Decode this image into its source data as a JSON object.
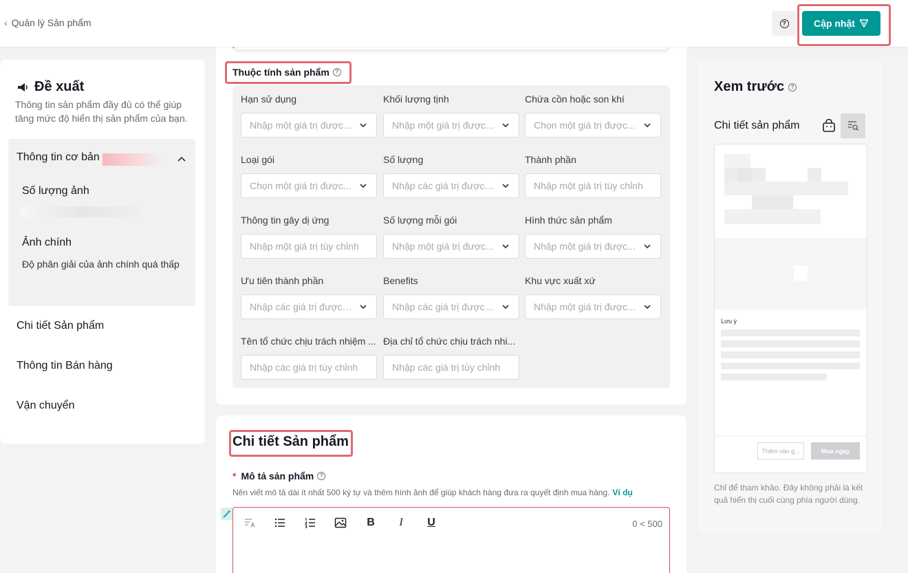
{
  "header": {
    "back_label": "Quản lý Sản phẩm",
    "update_label": "Cập nhật"
  },
  "sidebar": {
    "suggest_title": "Đề xuất",
    "suggest_desc": "Thông tin sản phẩm đầy đủ có thể giúp tăng mức độ hiển thị sản phẩm của bạn.",
    "basic_info_label": "Thông tin cơ bản",
    "image_count_label": "Số lượng ảnh",
    "main_image_label": "Ảnh chính",
    "main_image_desc": "Độ phân giải của ảnh chính quá thấp",
    "nav": [
      "Chi tiết Sản phẩm",
      "Thông tin Bán hàng",
      "Vận chuyển"
    ]
  },
  "attributes": {
    "title": "Thuộc tính sản phẩm",
    "fields": [
      {
        "label": "Hạn sử dụng",
        "placeholder": "Nhập một giá trị được...",
        "dropdown": true
      },
      {
        "label": "Khối lượng tịnh",
        "placeholder": "Nhập một giá trị được...",
        "dropdown": true
      },
      {
        "label": "Chứa cồn hoặc son khí",
        "placeholder": "Chọn một giá trị được...",
        "dropdown": true
      },
      {
        "label": "Loại gói",
        "placeholder": "Chọn một giá trị được...",
        "dropdown": true
      },
      {
        "label": "Số lượng",
        "placeholder": "Nhập các giá trị được ...",
        "dropdown": true
      },
      {
        "label": "Thành phần",
        "placeholder": "Nhập một giá trị tùy chỉnh",
        "dropdown": false
      },
      {
        "label": "Thông tin gây dị ứng",
        "placeholder": "Nhập một giá trị tùy chỉnh",
        "dropdown": false
      },
      {
        "label": "Số lượng mỗi gói",
        "placeholder": "Nhập một giá trị được...",
        "dropdown": true
      },
      {
        "label": "Hình thức sản phẩm",
        "placeholder": "Nhập một giá trị được...",
        "dropdown": true
      },
      {
        "label": "Ưu tiên thành phần",
        "placeholder": "Nhập các giá trị được ...",
        "dropdown": true
      },
      {
        "label": "Benefits",
        "placeholder": "Nhập các giá trị được ...",
        "dropdown": true
      },
      {
        "label": "Khu vực xuất xứ",
        "placeholder": "Nhập một giá trị được...",
        "dropdown": true
      },
      {
        "label": "Tên tổ chức chịu trách nhiệm ...",
        "placeholder": "Nhập các giá trị tùy chỉnh",
        "dropdown": false
      },
      {
        "label": "Địa chỉ tổ chức chịu trách nhi...",
        "placeholder": "Nhập các giá trị tùy chỉnh",
        "dropdown": false
      }
    ]
  },
  "detail": {
    "title": "Chi tiết Sản phẩm",
    "desc_required_mark": "*",
    "desc_label": "Mô tả sản phẩm",
    "desc_hint": "Nên viết mô tả dài ít nhất 500 ký tự và thêm hình ảnh để giúp khách hàng đưa ra quyết định mua hàng.",
    "desc_hint_link": "Ví dụ",
    "counter": "0 < 500",
    "toolbar_icons": [
      "text-style-icon",
      "bullet-list-icon",
      "numbered-list-icon",
      "image-icon",
      "bold-icon",
      "italic-icon",
      "underline-icon"
    ]
  },
  "preview": {
    "title": "Xem trước",
    "sub_title": "Chi tiết sản phẩm",
    "note_label": "Lưu ý",
    "add_to_cart": "Thêm vào g...",
    "buy_now": "Mua ngay",
    "disclaimer": "Chỉ để tham khảo. Đây không phải là kết quả hiển thị cuối cùng phía người dùng."
  },
  "colors": {
    "accent": "#009995",
    "highlight_frame": "#e06b71"
  }
}
